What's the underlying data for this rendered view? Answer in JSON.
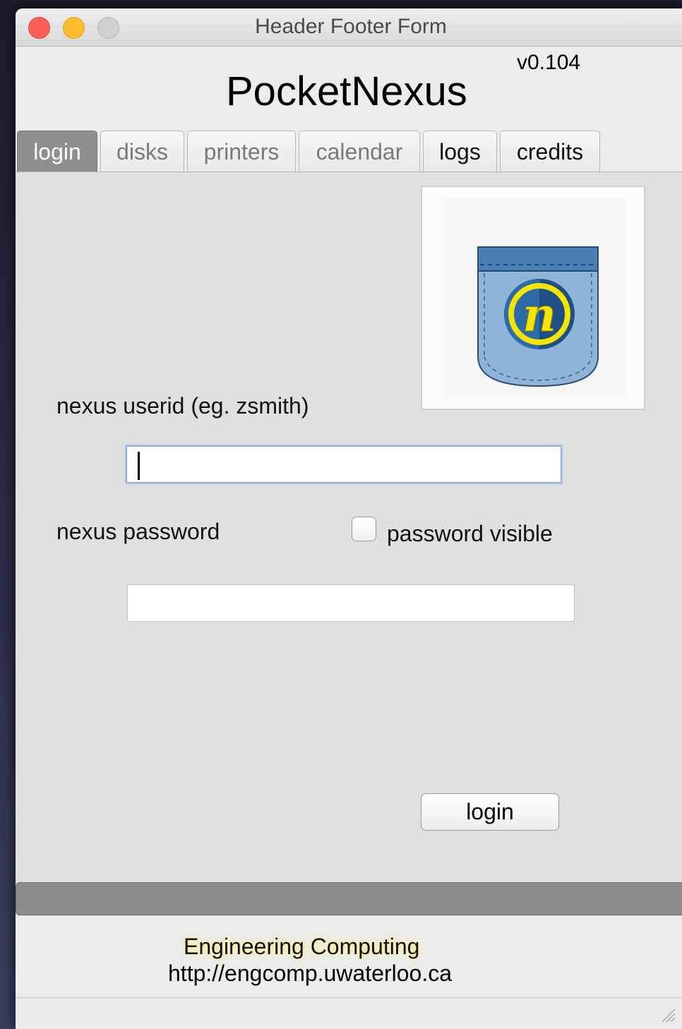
{
  "window": {
    "title": "Header Footer Form"
  },
  "header": {
    "app_name": "PocketNexus",
    "version": "v0.104"
  },
  "tabs": [
    {
      "label": "login"
    },
    {
      "label": "disks"
    },
    {
      "label": "printers"
    },
    {
      "label": "calendar"
    },
    {
      "label": "logs"
    },
    {
      "label": "credits"
    }
  ],
  "active_tab": "login",
  "form": {
    "userid_label": "nexus userid (eg. zsmith)",
    "userid_value": "",
    "password_label": "nexus password",
    "password_value": "",
    "password_visible_label": "password visible",
    "password_visible_checked": false,
    "login_button": "login"
  },
  "logo": {
    "icon": "pocket-nexus-logo-icon",
    "colors": {
      "pocket": "#8eb4d8",
      "pocket_top": "#4a7fb5",
      "circle": "#1f4f85",
      "letter": "#f2e600"
    }
  },
  "footer": {
    "org": "Engineering Computing",
    "url": "http://engcomp.uwaterloo.ca"
  },
  "colors": {
    "close": "#fc5f57",
    "minimize": "#fdbc2e",
    "maximize": "#d0d0d0",
    "active_tab": "#8f8f8f",
    "statusbar": "#8c8c8c"
  }
}
